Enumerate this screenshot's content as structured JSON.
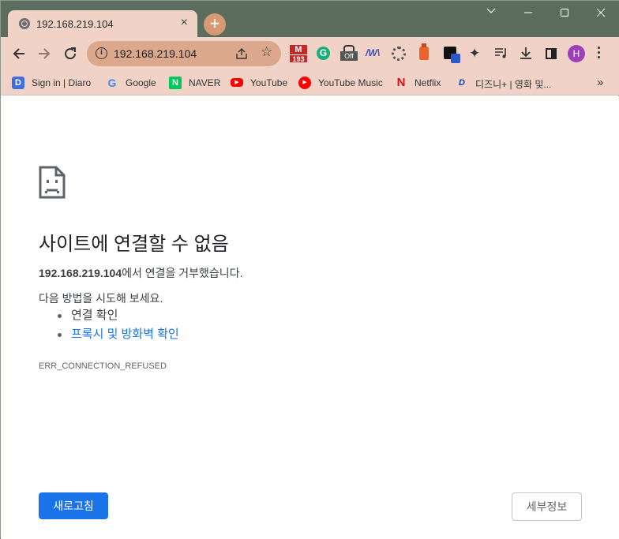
{
  "tab": {
    "title": "192.168.219.104",
    "close_glyph": "×",
    "new_tab_glyph": "+"
  },
  "window_controls": {
    "minimize": "minimize-icon",
    "maximize": "maximize-icon",
    "close": "close-icon",
    "tabsearch": "chevron-down-icon"
  },
  "toolbar": {
    "url": "192.168.219.104",
    "info_glyph": "i",
    "star_glyph": "☆",
    "gmail_count": "193",
    "gmail_letter": "M",
    "grammarly_letter": "G",
    "off_label": "Off",
    "wave_label": "/W\\",
    "puzzle_glyph": "✦",
    "avatar_letter": "H"
  },
  "bookmarks": {
    "items": [
      {
        "label": "Sign in | Diaro",
        "icon": "D"
      },
      {
        "label": "Google",
        "icon": "G"
      },
      {
        "label": "NAVER",
        "icon": "N"
      },
      {
        "label": "YouTube",
        "icon": "▶"
      },
      {
        "label": "YouTube Music",
        "icon": "▶"
      },
      {
        "label": "Netflix",
        "icon": "N"
      },
      {
        "label": "디즈니+ | 영화 및...",
        "icon": "D"
      }
    ],
    "more_glyph": "»"
  },
  "error_page": {
    "heading": "사이트에 연결할 수 없음",
    "host": "192.168.219.104",
    "summary_suffix": "에서 연결을 거부했습니다.",
    "suggest_title": "다음 방법을 시도해 보세요.",
    "suggestions": [
      "연결 확인",
      "프록시 및 방화벽 확인"
    ],
    "error_code": "ERR_CONNECTION_REFUSED",
    "reload_label": "새로고침",
    "details_label": "세부정보"
  },
  "colors": {
    "frame": "#5c6c5d",
    "tab_toolbar": "#f0d3c6",
    "omnibox": "#dba88d",
    "accent_blue": "#1a73e8",
    "avatar": "#9c3fb9"
  }
}
